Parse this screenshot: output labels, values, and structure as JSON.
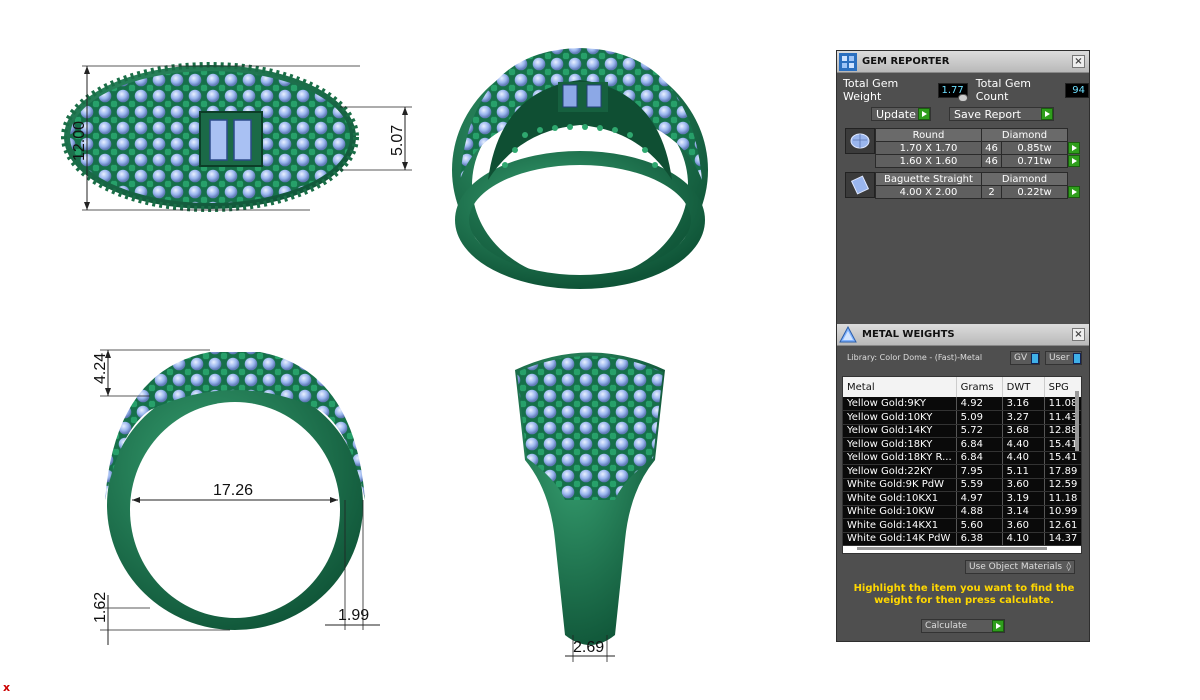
{
  "dimensions": {
    "top_height": "12.00",
    "top_center": "5.07",
    "side_height": "4.24",
    "inner_diameter": "17.26",
    "shank_bottom": "1.62",
    "shank_width": "1.99",
    "profile_width": "2.69"
  },
  "gem_reporter": {
    "title": "GEM REPORTER",
    "close": "×",
    "total_weight_label": "Total Gem Weight",
    "total_weight_value": "1.77",
    "total_count_label": "Total Gem Count",
    "total_count_value": "94",
    "update_label": "Update",
    "save_report_label": "Save Report",
    "groups": [
      {
        "shape": "Round",
        "material": "Diamond",
        "rows": [
          {
            "size": "1.70 X 1.70",
            "count": "46",
            "weight": "0.85tw"
          },
          {
            "size": "1.60 X 1.60",
            "count": "46",
            "weight": "0.71tw"
          }
        ]
      },
      {
        "shape": "Baguette Straight",
        "material": "Diamond",
        "rows": [
          {
            "size": "4.00 X 2.00",
            "count": "2",
            "weight": "0.22tw"
          }
        ]
      }
    ]
  },
  "metal_weights": {
    "title": "METAL WEIGHTS",
    "close": "×",
    "library": "Library: Color Dome - (Fast)-Metal",
    "gv_label": "GV",
    "user_label": "User",
    "columns": [
      "Metal",
      "Grams",
      "DWT",
      "SPG"
    ],
    "rows": [
      [
        "Yellow Gold:9KY",
        "4.92",
        "3.16",
        "11.08"
      ],
      [
        "Yellow Gold:10KY",
        "5.09",
        "3.27",
        "11.43"
      ],
      [
        "Yellow Gold:14KY",
        "5.72",
        "3.68",
        "12.88"
      ],
      [
        "Yellow Gold:18KY",
        "6.84",
        "4.40",
        "15.41"
      ],
      [
        "Yellow Gold:18KY R...",
        "6.84",
        "4.40",
        "15.41"
      ],
      [
        "Yellow Gold:22KY",
        "7.95",
        "5.11",
        "17.89"
      ],
      [
        "White Gold:9K PdW",
        "5.59",
        "3.60",
        "12.59"
      ],
      [
        "White Gold:10KX1",
        "4.97",
        "3.19",
        "11.18"
      ],
      [
        "White Gold:10KW",
        "4.88",
        "3.14",
        "10.99"
      ],
      [
        "White Gold:14KX1",
        "5.60",
        "3.60",
        "12.61"
      ],
      [
        "White Gold:14K PdW",
        "6.38",
        "4.10",
        "14.37"
      ]
    ],
    "use_object_materials": "Use Object Materials",
    "hint": "Highlight the item you want to find the weight for then press calculate.",
    "calculate_label": "Calculate"
  },
  "corner_mark": "x",
  "colors": {
    "metal": "#1e7a52",
    "gem": "#9ab6ee",
    "panel_bg": "#4f4f4f",
    "hint": "#ffd700"
  }
}
